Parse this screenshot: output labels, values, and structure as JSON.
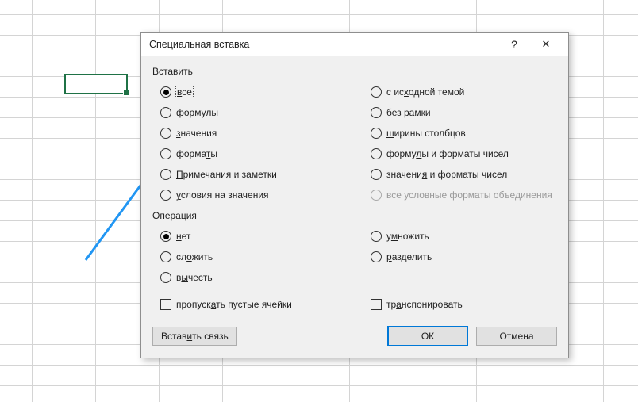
{
  "dialog": {
    "title": "Специальная вставка",
    "help": "?",
    "close": "✕"
  },
  "paste_group": {
    "label": "Вставить",
    "left": [
      {
        "html": "<u>в</u>се",
        "selected": true,
        "focused": true
      },
      {
        "html": "<u>ф</u>ормулы"
      },
      {
        "html": "<u>з</u>начения"
      },
      {
        "html": "форма<u>т</u>ы"
      },
      {
        "html": "<u>П</u>римечания и заметки"
      },
      {
        "html": "<u>у</u>словия на значения"
      }
    ],
    "right": [
      {
        "html": "с ис<u>х</u>одной темой"
      },
      {
        "html": "без рам<u>к</u>и"
      },
      {
        "html": "<u>ш</u>ирины столбцов"
      },
      {
        "html": "форму<u>л</u>ы и форматы чисел"
      },
      {
        "html": "значени<u>я</u> и форматы чисел"
      },
      {
        "html": "все условные форматы объединения",
        "disabled": true
      }
    ]
  },
  "op_group": {
    "label": "Операция",
    "left": [
      {
        "html": "<u>н</u>ет",
        "selected": true
      },
      {
        "html": "сл<u>о</u>жить"
      },
      {
        "html": "в<u>ы</u>честь"
      }
    ],
    "right": [
      {
        "html": "у<u>м</u>ножить"
      },
      {
        "html": "<u>р</u>азделить"
      }
    ]
  },
  "checks": {
    "skip_blanks": "пропуск<u>а</u>ть пустые ячейки",
    "transpose": "тр<u>а</u>нспонировать"
  },
  "buttons": {
    "paste_link": "Встав<u>и</u>ть связь",
    "ok": "ОК",
    "cancel": "Отмена"
  }
}
